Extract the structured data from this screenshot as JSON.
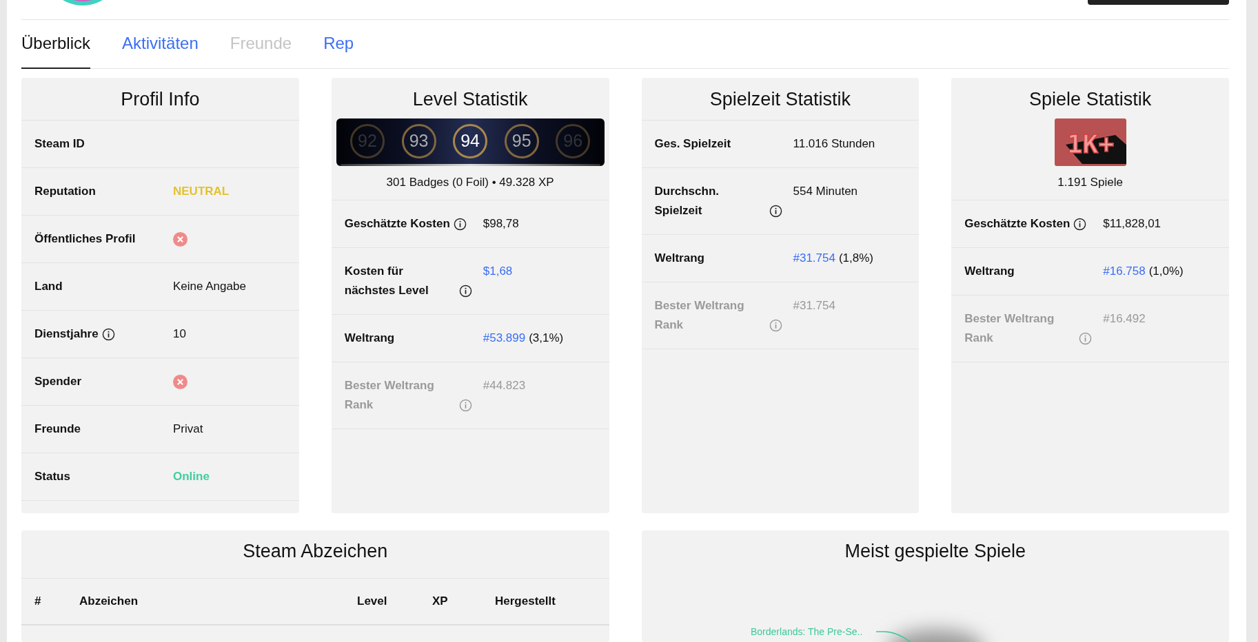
{
  "tabs": [
    {
      "label": "Überblick",
      "selected": true,
      "disabled": false
    },
    {
      "label": "Aktivitäten",
      "selected": false,
      "disabled": false
    },
    {
      "label": "Freunde",
      "selected": false,
      "disabled": true
    },
    {
      "label": "Rep",
      "selected": false,
      "disabled": false
    }
  ],
  "cards": [
    {
      "kind": "rows",
      "title": "Profil Info",
      "rows": [
        {
          "label": "Steam ID",
          "info": false,
          "muted": false,
          "kind": "empty"
        },
        {
          "label": "Reputation",
          "info": false,
          "muted": false,
          "kind": "status",
          "value": "NEUTRAL",
          "color": "#e3c22f"
        },
        {
          "label": "Öffentliches Profil",
          "info": false,
          "muted": false,
          "kind": "flag",
          "checked": false
        },
        {
          "label": "Land",
          "info": false,
          "muted": false,
          "kind": "text",
          "value": "Keine Angabe"
        },
        {
          "label": "Dienstjahre",
          "info": true,
          "muted": false,
          "kind": "text",
          "value": "10"
        },
        {
          "label": "Spender",
          "info": false,
          "muted": false,
          "kind": "flag",
          "checked": false
        },
        {
          "label": "Freunde",
          "info": false,
          "muted": false,
          "kind": "text",
          "value": "Privat"
        },
        {
          "label": "Status",
          "info": false,
          "muted": false,
          "kind": "status",
          "value": "Online",
          "color": "#3fcf9f"
        }
      ]
    },
    {
      "kind": "levels",
      "title": "Level Statistik",
      "levels": [
        {
          "label": "92",
          "selected": false
        },
        {
          "label": "93",
          "selected": false
        },
        {
          "label": "94",
          "selected": true
        },
        {
          "label": "95",
          "selected": false
        },
        {
          "label": "96",
          "selected": false
        }
      ],
      "caption": "301 Badges (0 Foil) • 49.328 XP",
      "rows": [
        {
          "label": "Geschätzte Kosten",
          "info": true,
          "muted": false,
          "kind": "text",
          "value": "$98,78"
        },
        {
          "label": "Kosten für nächstes Level",
          "info": true,
          "muted": false,
          "kind": "link",
          "value": "$1,68"
        },
        {
          "label": "Weltrang",
          "info": false,
          "muted": false,
          "kind": "link",
          "value": "#53.899",
          "suffix": "(3,1%)"
        },
        {
          "label": "Bester Weltrang Rank",
          "info": true,
          "muted": true,
          "kind": "text",
          "value": "#44.823"
        }
      ]
    },
    {
      "kind": "rows",
      "title": "Spielzeit Statistik",
      "rows": [
        {
          "label": "Ges. Spielzeit",
          "info": false,
          "muted": false,
          "kind": "text",
          "value": "11.016 Stunden"
        },
        {
          "label": "Durchschn. Spielzeit",
          "info": true,
          "muted": false,
          "kind": "text",
          "value": "554 Minuten"
        },
        {
          "label": "Weltrang",
          "info": false,
          "muted": false,
          "kind": "link",
          "value": "#31.754",
          "suffix": "(1,8%)"
        },
        {
          "label": "Bester Weltrang Rank",
          "info": true,
          "muted": true,
          "kind": "text",
          "value": "#31.754"
        }
      ]
    },
    {
      "kind": "games",
      "title": "Spiele Statistik",
      "badge": "1K+",
      "caption": "1.191 Spiele",
      "rows": [
        {
          "label": "Geschätzte Kosten",
          "info": true,
          "muted": false,
          "kind": "text",
          "value": "$11,828,01"
        },
        {
          "label": "Weltrang",
          "info": false,
          "muted": false,
          "kind": "link",
          "value": "#16.758",
          "suffix": "(1,0%)"
        },
        {
          "label": "Bester Weltrang Rank",
          "info": true,
          "muted": true,
          "kind": "text",
          "value": "#16.492"
        }
      ]
    }
  ],
  "badges": {
    "title": "Steam Abzeichen",
    "columns": [
      "#",
      "Abzeichen",
      "Level",
      "XP",
      "Hergestellt"
    ]
  },
  "top_games": {
    "title": "Meist gespielte Spiele",
    "labels": [
      "Borderlands: The Pre-Se.."
    ]
  }
}
